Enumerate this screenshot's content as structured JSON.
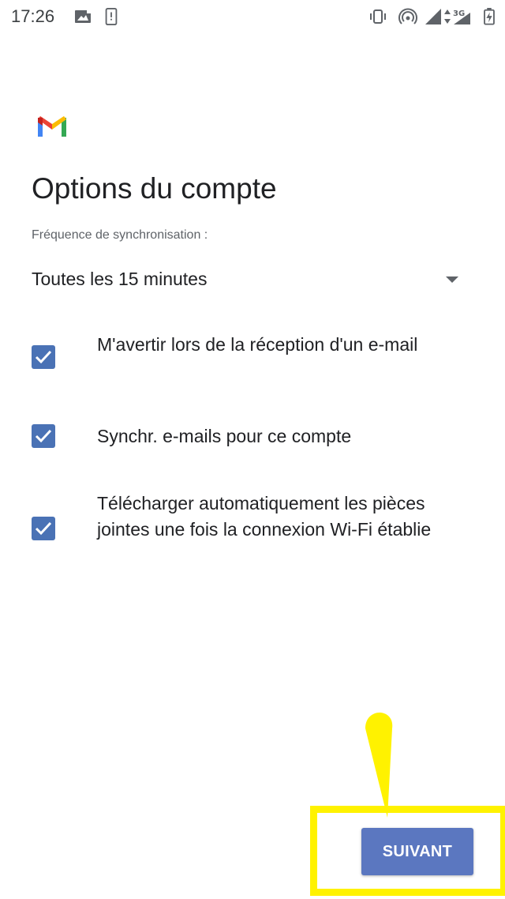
{
  "status_bar": {
    "time": "17:26",
    "icons": [
      "gallery-notification-icon",
      "sim-alert-icon",
      "vibrate-icon",
      "hotspot-icon",
      "signal-icon",
      "network-3g-icon",
      "battery-charging-icon"
    ],
    "network_label": "3G"
  },
  "screen": {
    "title": "Options du compte",
    "sync_label": "Fréquence de synchronisation :",
    "sync_value": "Toutes les 15 minutes"
  },
  "options": [
    {
      "label": "M'avertir lors de la réception d'un e-mail",
      "checked": true
    },
    {
      "label": "Synchr. e-mails pour ce compte",
      "checked": true
    },
    {
      "label": "Télécharger automatiquement les pièces jointes une fois la connexion Wi-Fi établie",
      "checked": true
    }
  ],
  "actions": {
    "next_label": "SUIVANT"
  },
  "colors": {
    "accent": "#4a72b5",
    "button": "#5b77c0",
    "highlight": "#fff200"
  }
}
